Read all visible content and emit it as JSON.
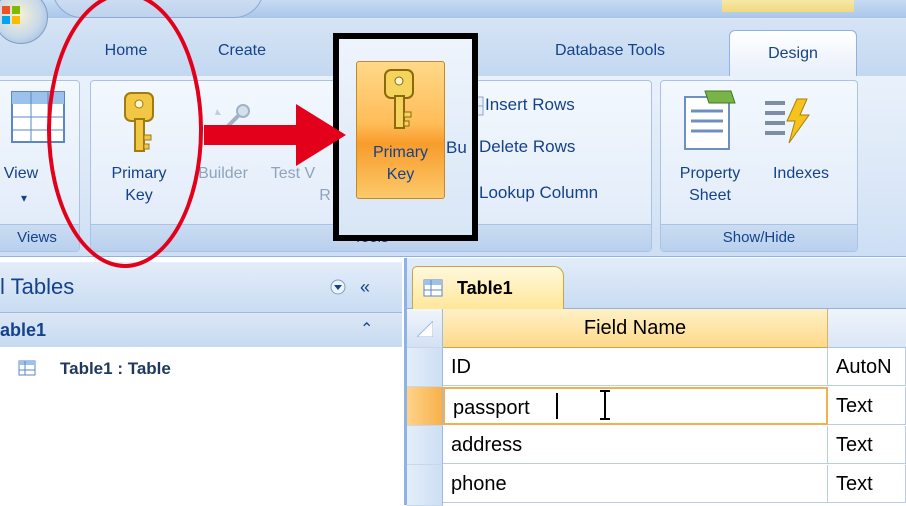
{
  "tabs": {
    "home": "Home",
    "create": "Create",
    "database_tools": "Database Tools",
    "design": "Design"
  },
  "ribbon": {
    "views_group": {
      "view_label": "View",
      "label": "Views"
    },
    "tools_group": {
      "primary_key_line1": "Primary",
      "primary_key_line2": "Key",
      "builder": "Builder",
      "test_v": "Test V",
      "test_r": "R",
      "label": "Tools",
      "insert_rows": "Insert Rows",
      "delete_rows": "Delete Rows",
      "lookup_column": "Lookup Column",
      "overlap_bu": "Bu"
    },
    "showhide_group": {
      "property_line1": "Property",
      "property_line2": "Sheet",
      "indexes": "Indexes",
      "label": "Show/Hide"
    }
  },
  "highlight_button": {
    "line1": "Primary",
    "line2": "Key"
  },
  "nav": {
    "header": "l Tables",
    "collapse_glyph": "«",
    "group": "able1",
    "group_glyph": "⌃",
    "item": "Table1 : Table"
  },
  "document": {
    "tab": "Table1",
    "columns": [
      "Field Name",
      ""
    ],
    "rows": [
      {
        "field": "ID",
        "type": "AutoN"
      },
      {
        "field": "passport",
        "type": "Text"
      },
      {
        "field": "address",
        "type": "Text"
      },
      {
        "field": "phone",
        "type": "Text"
      }
    ]
  },
  "colors": {
    "ribbon_text": "#15428b",
    "highlight_orange": "#ffbd59",
    "annotation_red": "#e3001b"
  }
}
